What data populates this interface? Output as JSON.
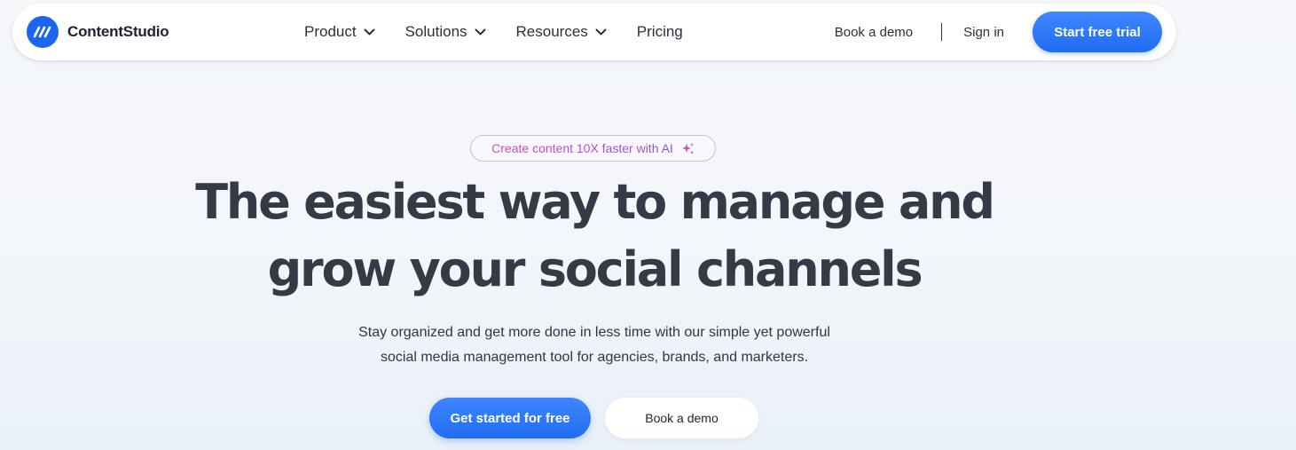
{
  "brand": {
    "name": "ContentStudio",
    "logo_icon": "contentstudio-logo-icon",
    "accent_color": "#1a66f0"
  },
  "nav": {
    "items": [
      {
        "label": "Product",
        "has_dropdown": true
      },
      {
        "label": "Solutions",
        "has_dropdown": true
      },
      {
        "label": "Resources",
        "has_dropdown": true
      },
      {
        "label": "Pricing",
        "has_dropdown": false
      }
    ],
    "book_demo": "Book a demo",
    "sign_in": "Sign in",
    "start_trial": "Start free trial"
  },
  "hero": {
    "badge": "Create content 10X faster with AI",
    "badge_icon": "sparkle-icon",
    "headline_line1": "The easiest way to manage and",
    "headline_line2": "grow your social channels",
    "subtext_line1": "Stay organized and get more done in less time with our simple yet powerful",
    "subtext_line2": "social media management tool for agencies, brands, and marketers.",
    "cta_primary": "Get started for free",
    "cta_secondary": "Book a demo"
  }
}
